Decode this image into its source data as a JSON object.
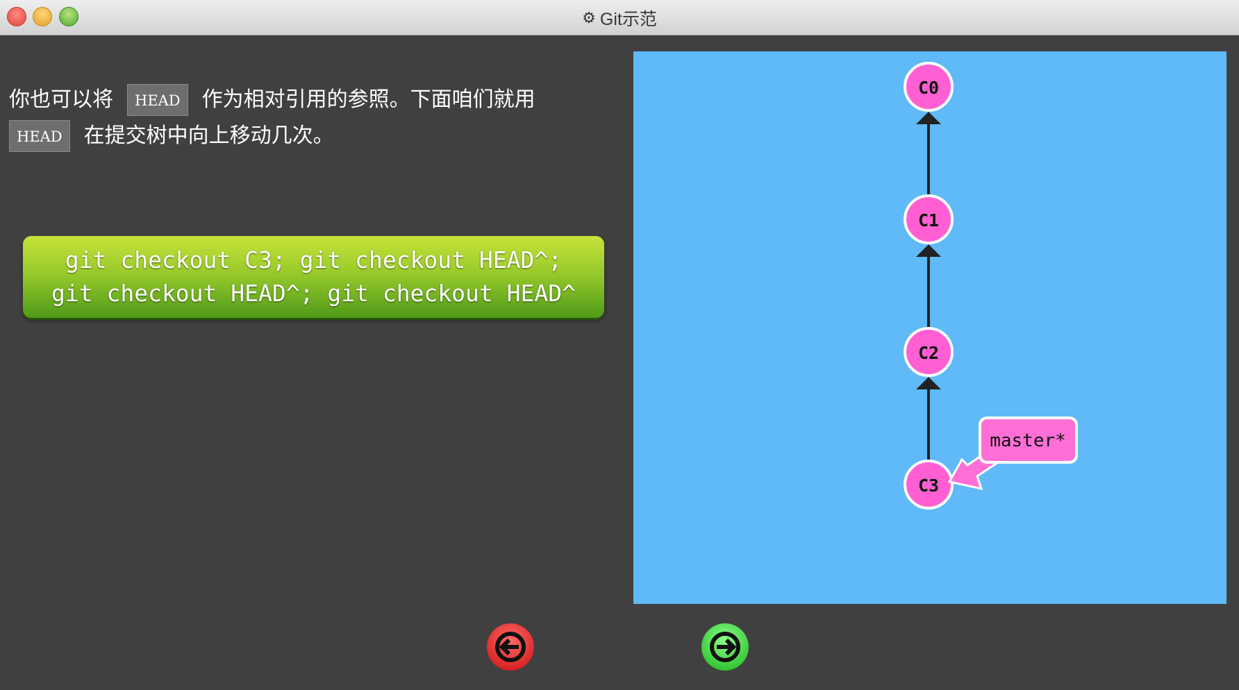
{
  "window": {
    "title": "Git示范",
    "title_icon": "gear-icon"
  },
  "intro": {
    "line1_a": "你也可以将",
    "head_tag": "HEAD",
    "line1_b": "作为相对引用的参照。下面咱们就用",
    "line2_b": "在提交树中向上移动几次。"
  },
  "command": {
    "text": "git checkout C3; git checkout HEAD^; git checkout HEAD^; git checkout HEAD^"
  },
  "tree": {
    "commits": [
      "C0",
      "C1",
      "C2",
      "C3"
    ],
    "branch_label": "master*"
  },
  "nav": {
    "prev_icon": "arrow-left-icon",
    "next_icon": "arrow-right-icon"
  },
  "colors": {
    "background": "#404040",
    "panel": "#5fbaf7",
    "commit_fill": "#ff5fd2",
    "branch_fill": "#ff6fd6",
    "command_green": "#6db324",
    "prev_red": "#ee2b2b",
    "next_green": "#4ce34c"
  }
}
